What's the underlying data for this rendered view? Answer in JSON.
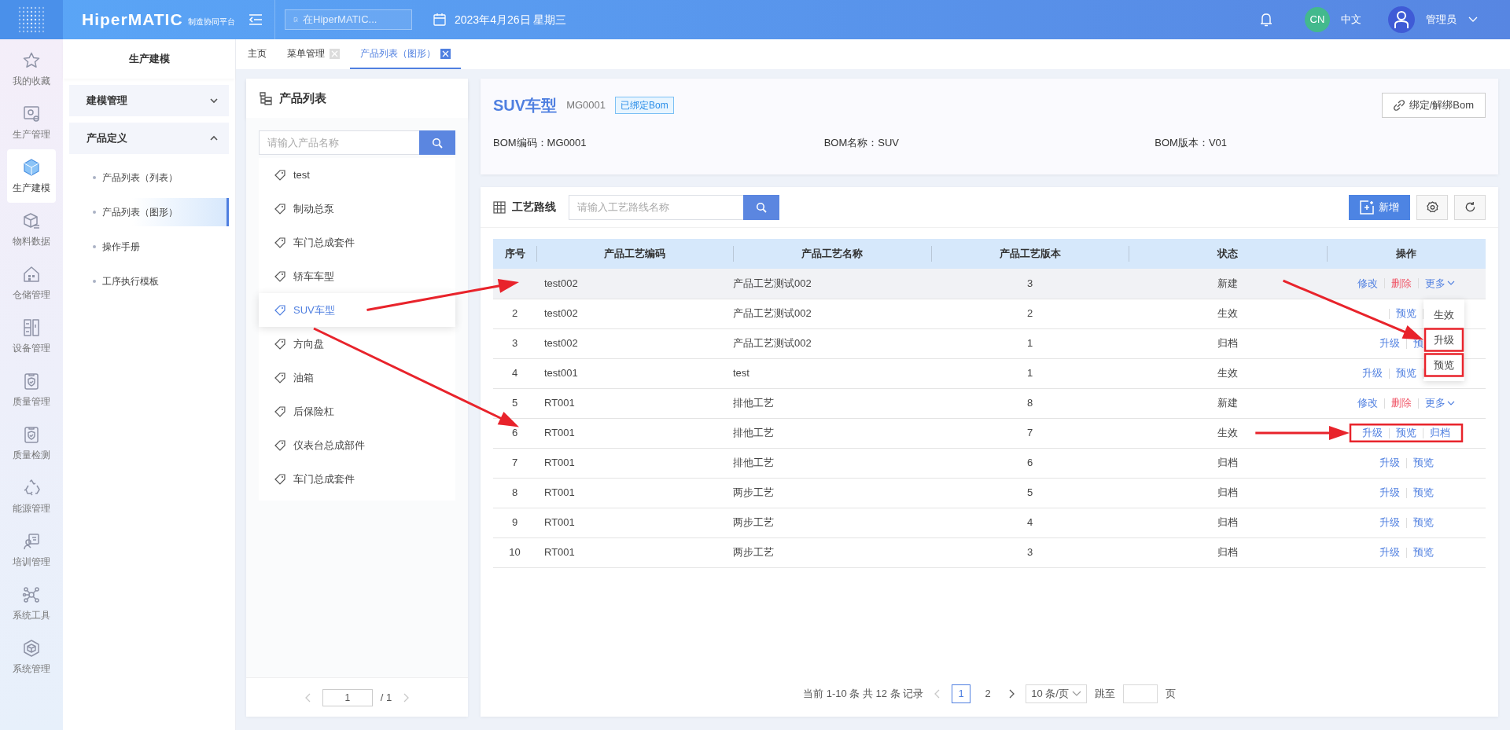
{
  "topbar": {
    "brand": "HiperMATIC",
    "brand_subtitle": "制造协同平台",
    "search": {
      "placeholder": "在HiperMATIC..."
    },
    "date": "2023年4月26日 星期三",
    "language_badge": "CN",
    "language": "中文",
    "user": "管理员"
  },
  "rail": [
    {
      "label": "我的收藏",
      "selected": false
    },
    {
      "label": "生产管理",
      "selected": false
    },
    {
      "label": "生产建模",
      "selected": true
    },
    {
      "label": "物料数据",
      "selected": false
    },
    {
      "label": "仓储管理",
      "selected": false
    },
    {
      "label": "设备管理",
      "selected": false
    },
    {
      "label": "质量管理",
      "selected": false
    },
    {
      "label": "质量检测",
      "selected": false
    },
    {
      "label": "能源管理",
      "selected": false
    },
    {
      "label": "培训管理",
      "selected": false
    },
    {
      "label": "系统工具",
      "selected": false
    },
    {
      "label": "系统管理",
      "selected": false
    }
  ],
  "sidebar": {
    "title": "生产建模",
    "groups": [
      {
        "label": "建模管理",
        "expanded": false
      },
      {
        "label": "产品定义",
        "expanded": true,
        "children": [
          {
            "label": "产品列表（列表）",
            "selected": false
          },
          {
            "label": "产品列表（图形）",
            "selected": true
          },
          {
            "label": "操作手册",
            "selected": false
          },
          {
            "label": "工序执行模板",
            "selected": false
          }
        ]
      }
    ]
  },
  "tabs": [
    {
      "label": "主页",
      "selected": false,
      "closable": false
    },
    {
      "label": "菜单管理",
      "selected": false,
      "closable": true
    },
    {
      "label": "产品列表（图形）",
      "selected": true,
      "closable": true
    }
  ],
  "product_panel": {
    "title": "产品列表",
    "search": {
      "placeholder": "请输入产品名称"
    },
    "items": [
      {
        "label": "test",
        "selected": false
      },
      {
        "label": "制动总泵",
        "selected": false
      },
      {
        "label": "车门总成套件",
        "selected": false
      },
      {
        "label": "轿车车型",
        "selected": false
      },
      {
        "label": "SUV车型",
        "selected": true
      },
      {
        "label": "方向盘",
        "selected": false
      },
      {
        "label": "油箱",
        "selected": false
      },
      {
        "label": "后保险杠",
        "selected": false
      },
      {
        "label": "仪表台总成部件",
        "selected": false
      },
      {
        "label": "车门总成套件",
        "selected": false
      }
    ],
    "pager": {
      "prev": {
        "disabled": true
      },
      "page": "1",
      "total": "/ 1",
      "next": {
        "disabled": true
      }
    }
  },
  "product_header": {
    "title": "SUV车型",
    "code": "MG0001",
    "tag": "已绑定Bom",
    "button": "绑定/解绑Bom",
    "fields": [
      "BOM编码：MG0001",
      "BOM名称：SUV",
      "BOM版本：V01"
    ]
  },
  "routes": {
    "title": "工艺路线",
    "search": {
      "placeholder": "请输入工艺路线名称"
    },
    "add_button": "新增",
    "table": {
      "columns": [
        "序号",
        "产品工艺编码",
        "产品工艺名称",
        "产品工艺版本",
        "状态",
        "操作"
      ],
      "rows": [
        {
          "code": "test002",
          "name": "产品工艺测试002",
          "version": "3",
          "status": "新建",
          "hovered": true,
          "menu_open": true,
          "ops": [
            {
              "label": "修改",
              "kind": "link"
            },
            {
              "label": "删除",
              "kind": "danger"
            },
            {
              "label": "更多",
              "kind": "menu"
            }
          ]
        },
        {
          "index": "2",
          "code": "test002",
          "name": "产品工艺测试002",
          "version": "2",
          "status": "生效",
          "hovered": false,
          "menu_open": false,
          "ops": [
            {
              "kind": "covered"
            },
            {
              "label": "预览",
              "kind": "link"
            },
            {
              "kind": "covered"
            }
          ]
        },
        {
          "index": "3",
          "code": "test002",
          "name": "产品工艺测试002",
          "version": "1",
          "status": "归档",
          "hovered": false,
          "menu_open": false,
          "ops": [
            {
              "label": "升级",
              "kind": "link"
            },
            {
              "label": "预",
              "kind": "link"
            }
          ]
        },
        {
          "index": "4",
          "code": "test001",
          "name": "test",
          "version": "1",
          "status": "生效",
          "hovered": false,
          "menu_open": false,
          "ops": [
            {
              "label": "升级",
              "kind": "link"
            },
            {
              "label": "预览",
              "kind": "link"
            },
            {
              "kind": "covered"
            }
          ]
        },
        {
          "index": "5",
          "code": "RT001",
          "name": "排他工艺",
          "version": "8",
          "status": "新建",
          "hovered": false,
          "menu_open": false,
          "ops": [
            {
              "label": "修改",
              "kind": "link"
            },
            {
              "label": "删除",
              "kind": "danger"
            },
            {
              "label": "更多",
              "kind": "menu"
            }
          ]
        },
        {
          "index": "6",
          "code": "RT001",
          "name": "排他工艺",
          "version": "7",
          "status": "生效",
          "hovered": false,
          "menu_open": false,
          "ops": [
            {
              "label": "升级",
              "kind": "link"
            },
            {
              "label": "预览",
              "kind": "link"
            },
            {
              "label": "归档",
              "kind": "link"
            }
          ]
        },
        {
          "index": "7",
          "code": "RT001",
          "name": "排他工艺",
          "version": "6",
          "status": "归档",
          "hovered": false,
          "menu_open": false,
          "ops": [
            {
              "label": "升级",
              "kind": "link"
            },
            {
              "label": "预览",
              "kind": "link"
            }
          ]
        },
        {
          "index": "8",
          "code": "RT001",
          "name": "两步工艺",
          "version": "5",
          "status": "归档",
          "hovered": false,
          "menu_open": false,
          "ops": [
            {
              "label": "升级",
              "kind": "link"
            },
            {
              "label": "预览",
              "kind": "link"
            }
          ]
        },
        {
          "index": "9",
          "code": "RT001",
          "name": "两步工艺",
          "version": "4",
          "status": "归档",
          "hovered": false,
          "menu_open": false,
          "ops": [
            {
              "label": "升级",
              "kind": "link"
            },
            {
              "label": "预览",
              "kind": "link"
            }
          ]
        },
        {
          "index": "10",
          "code": "RT001",
          "name": "两步工艺",
          "version": "3",
          "status": "归档",
          "hovered": false,
          "menu_open": false,
          "ops": [
            {
              "label": "升级",
              "kind": "link"
            },
            {
              "label": "预览",
              "kind": "link"
            }
          ]
        }
      ]
    },
    "row_menu": {
      "items": [
        "生效",
        "升级",
        "预览"
      ]
    },
    "pagination": {
      "summary": "当前 1-10 条 共 12 条 记录",
      "prev": {
        "disabled": true
      },
      "pages": [
        {
          "label": "1",
          "selected": true
        },
        {
          "label": "2",
          "selected": false
        }
      ],
      "next": {
        "disabled": false
      },
      "page_size": "10 条/页",
      "jump_label": "跳至",
      "page_unit": "页"
    }
  }
}
